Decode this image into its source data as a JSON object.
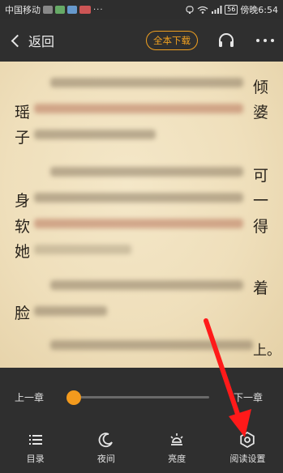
{
  "status_bar": {
    "carrier": "中国移动",
    "battery": "56",
    "time": "傍晚6:54"
  },
  "nav": {
    "back_label": "返回",
    "download_label": "全本下载"
  },
  "page": {
    "left_glyphs": [
      "瑶",
      "子",
      "身",
      "软",
      "她",
      "脸"
    ],
    "right_glyphs": [
      "倾",
      "婆",
      "可",
      "一",
      "得",
      "着",
      "上。"
    ]
  },
  "bottom": {
    "prev_chapter": "上一章",
    "next_chapter": "下一章",
    "progress_fraction": 0.0,
    "tabs": [
      {
        "label": "目录",
        "icon": "catalog-icon"
      },
      {
        "label": "夜间",
        "icon": "night-mode-icon"
      },
      {
        "label": "亮度",
        "icon": "brightness-icon"
      },
      {
        "label": "阅读设置",
        "icon": "reading-settings-icon"
      }
    ]
  },
  "colors": {
    "accent": "#f08c1a",
    "panel": "#2f2f2f",
    "page_bg": "#f1e3c2",
    "annotation": "#ff1a1a"
  }
}
